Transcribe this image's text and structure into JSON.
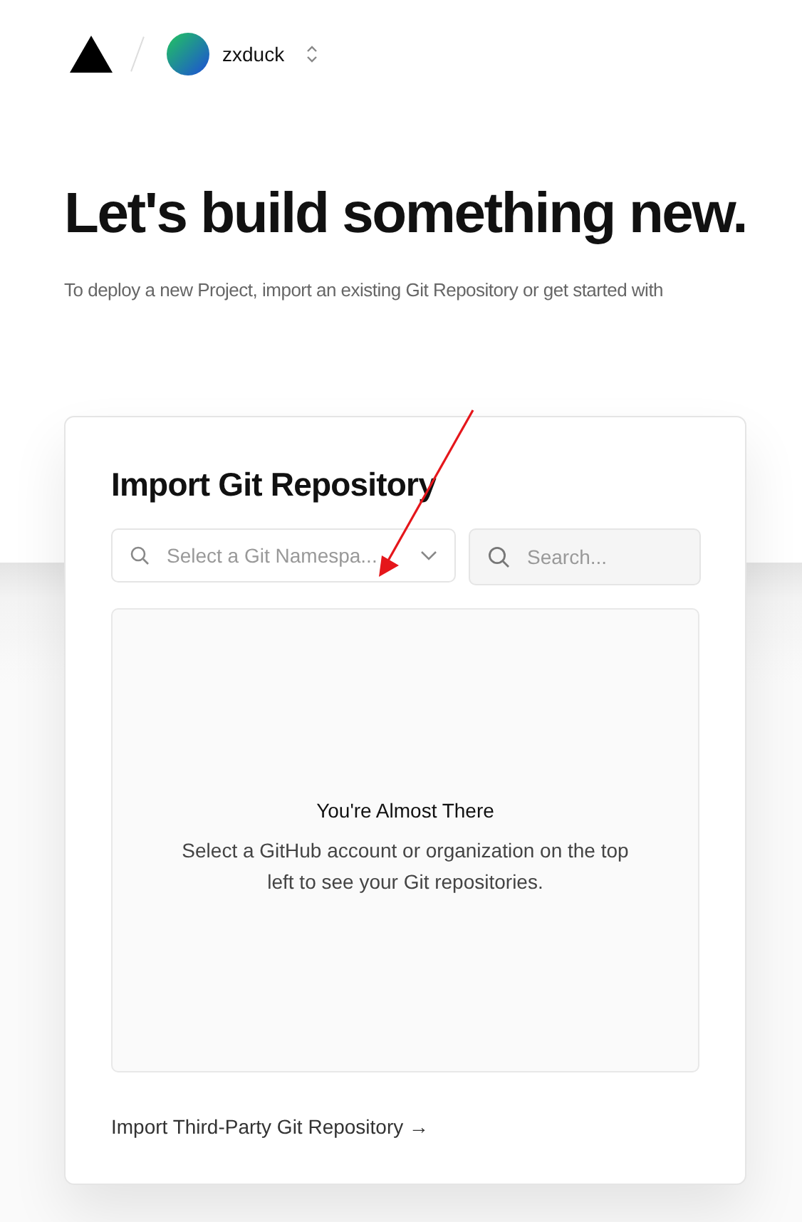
{
  "header": {
    "team": "zxduck"
  },
  "hero": {
    "title": "Let's build something new.",
    "subtitle": "To deploy a new Project, import an existing Git Repository or get started with"
  },
  "import_card": {
    "title": "Import Git Repository",
    "namespace_select": {
      "placeholder": "Select a Git Namespa..."
    },
    "search": {
      "placeholder": "Search..."
    },
    "empty_state": {
      "title": "You're Almost There",
      "text": "Select a GitHub account or organization on the top left to see your Git repositories."
    },
    "third_party_link": "Import Third-Party Git Repository →"
  }
}
